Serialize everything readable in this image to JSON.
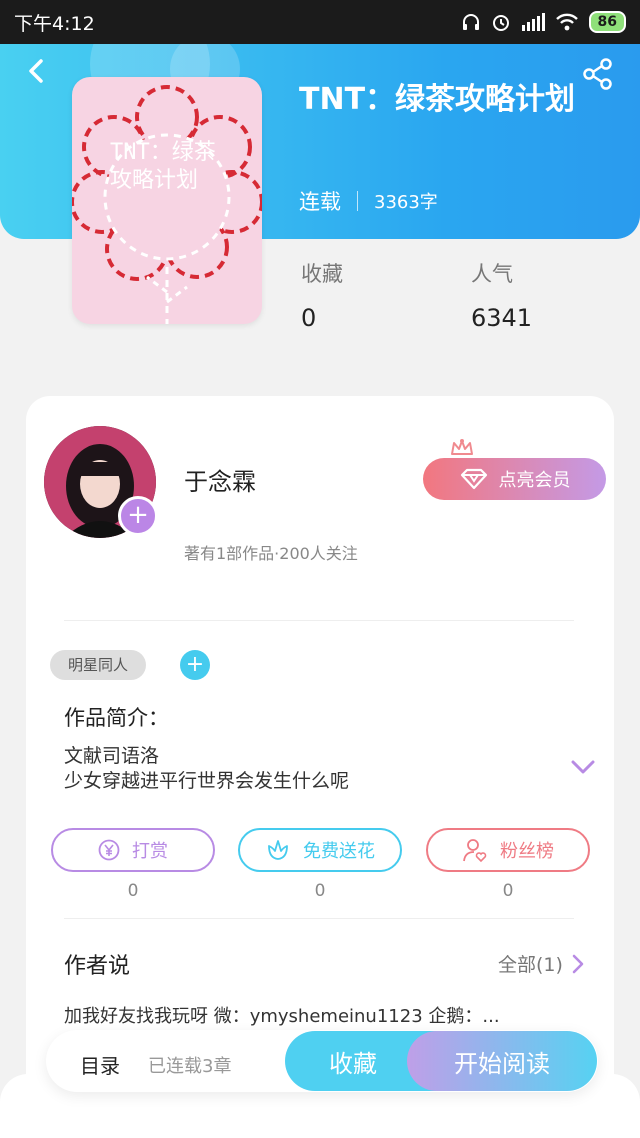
{
  "status_bar": {
    "time": "下午4:12",
    "battery": "86"
  },
  "book": {
    "cover_text": "TNT：绿茶攻略计划",
    "title": "TNT：绿茶攻略计划",
    "status": "连载",
    "word_count": "3363字",
    "stats": [
      {
        "label": "收藏",
        "value": "0"
      },
      {
        "label": "人气",
        "value": "6341"
      }
    ]
  },
  "author": {
    "name": "于念霖",
    "subtitle": "著有1部作品·200人关注",
    "vip_button": "点亮会员"
  },
  "tags": [
    "明星同人"
  ],
  "intro": {
    "title": "作品简介：",
    "lines": [
      "文献司语洛",
      "少女穿越进平行世界会发生什么呢"
    ]
  },
  "actions": [
    {
      "label": "打赏",
      "count": "0",
      "icon": "yen-icon",
      "color": "#b88be4"
    },
    {
      "label": "免费送花",
      "count": "0",
      "icon": "flower-icon",
      "color": "#45cbee"
    },
    {
      "label": "粉丝榜",
      "count": "0",
      "icon": "user-heart-icon",
      "color": "#ef7b84"
    }
  ],
  "author_says": {
    "title": "作者说",
    "all_label": "全部(1)",
    "text": "加我好友找我玩呀 微：ymyshemeinu1123 企鹅：..."
  },
  "bottom_bar": {
    "toc": "目录",
    "chapters": "已连载3章",
    "favorite": "收藏",
    "start_reading": "开始阅读"
  }
}
